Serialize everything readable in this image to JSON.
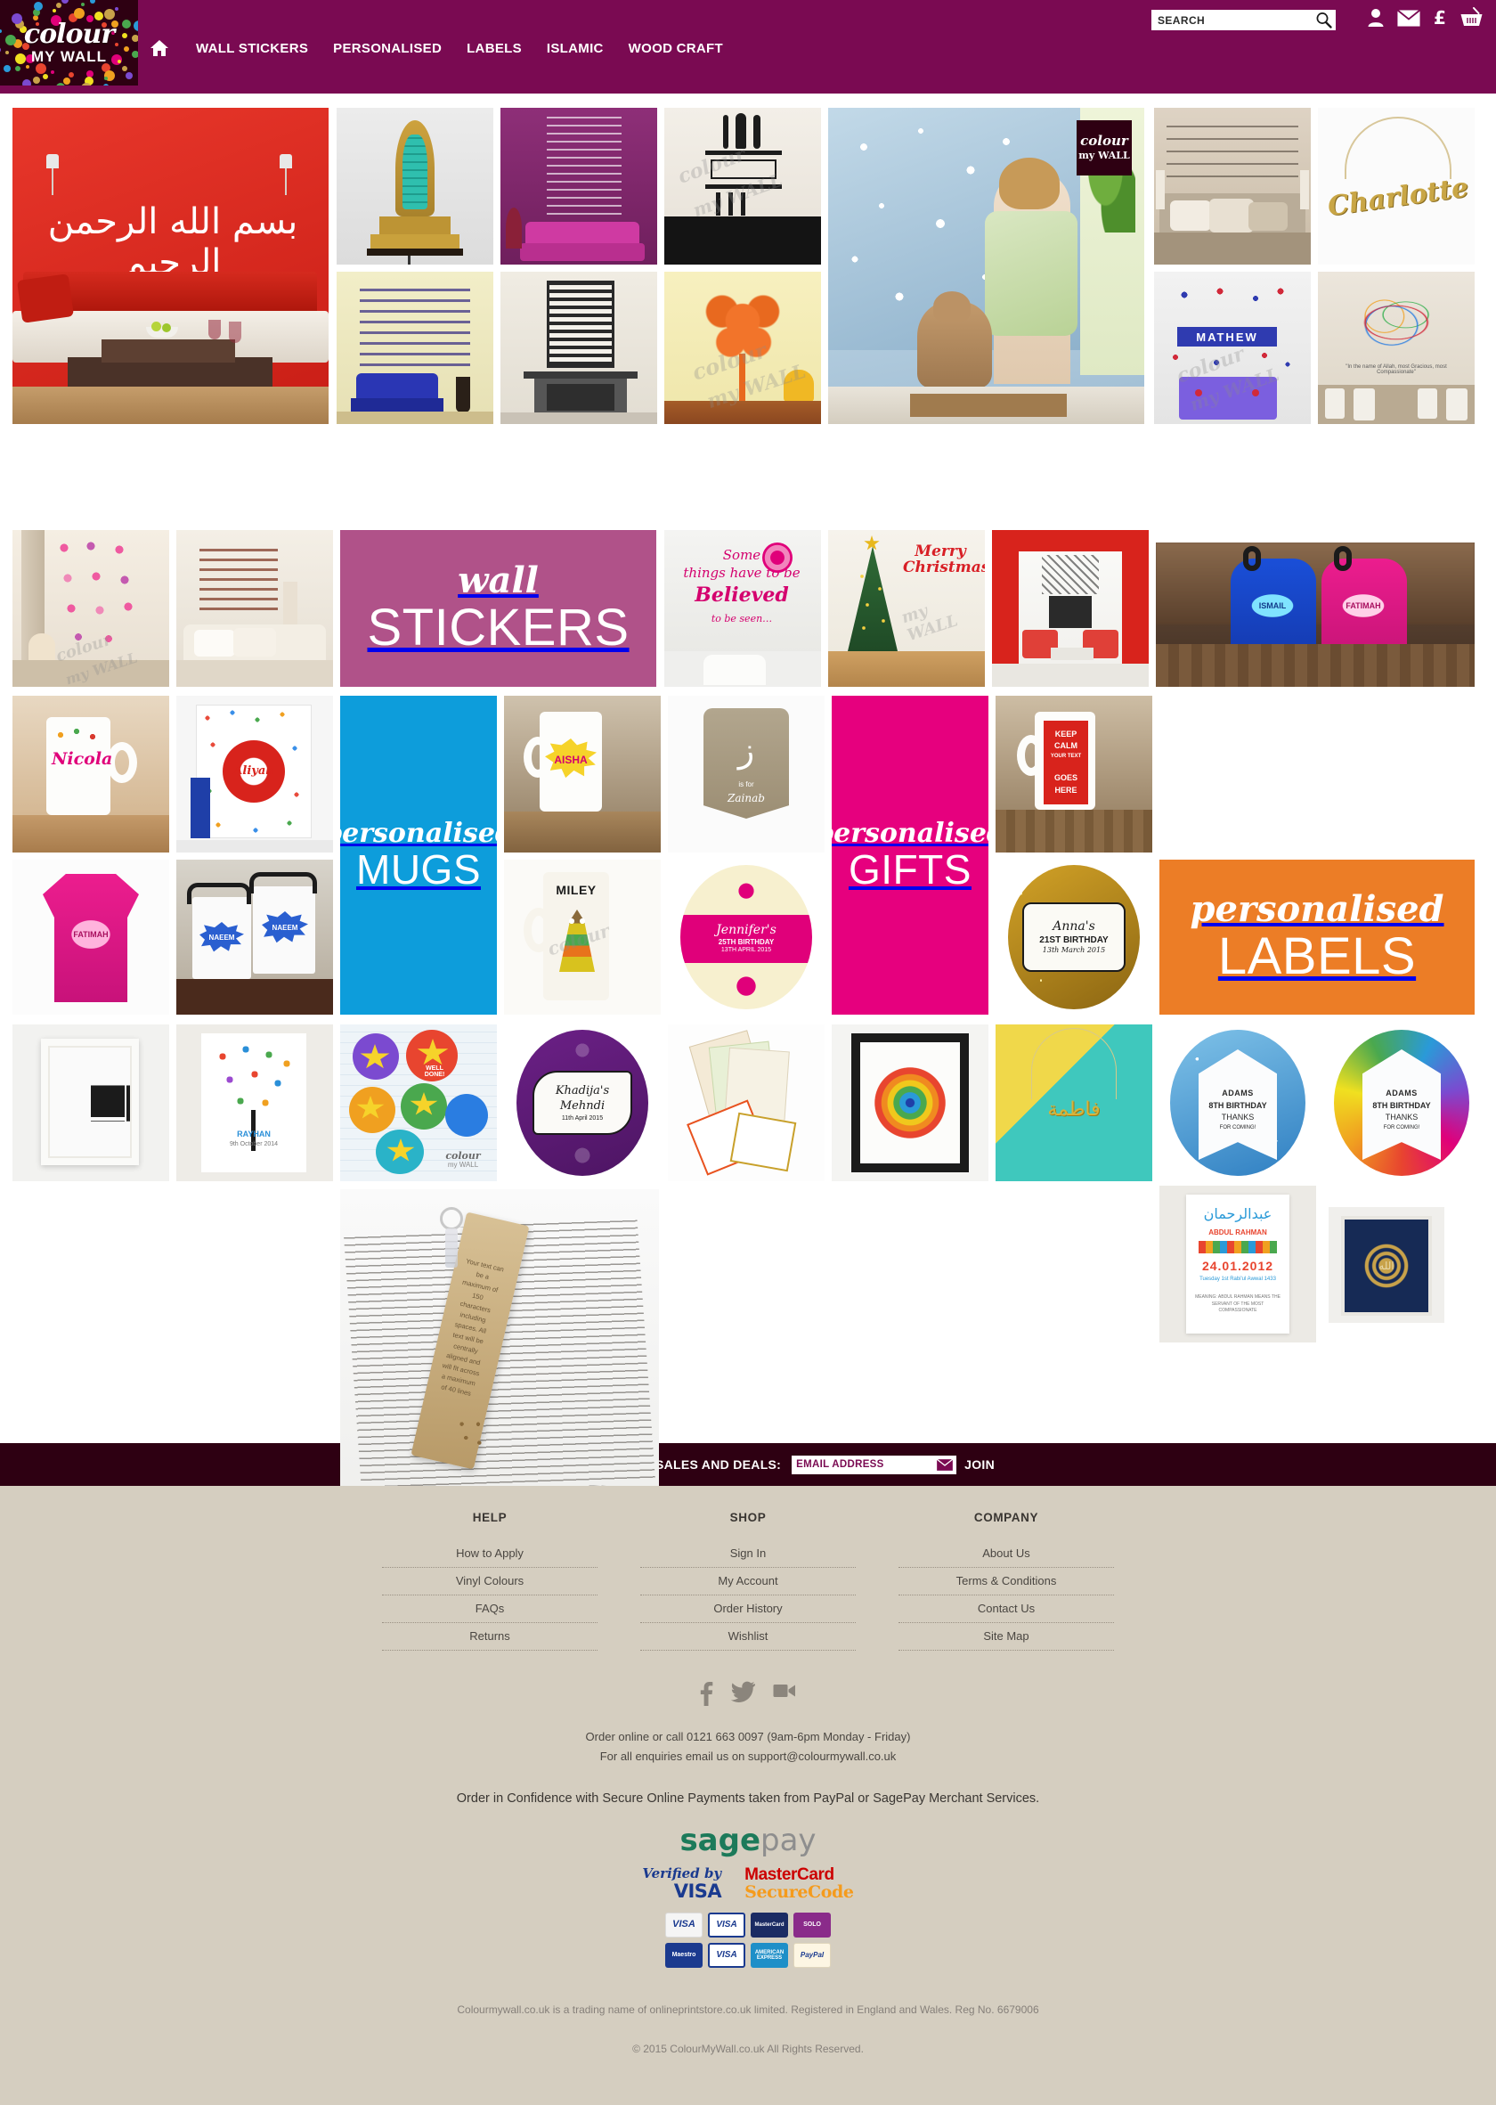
{
  "brand": {
    "logo_line1": "colour",
    "logo_line2": "MY WALL",
    "accent_purple": "#7a0a52",
    "accent_dark": "#2e0012",
    "footer_bg": "#d5cec0"
  },
  "header": {
    "home_icon": "home-icon",
    "nav": [
      {
        "label": "WALL STICKERS"
      },
      {
        "label": "PERSONALISED"
      },
      {
        "label": "LABELS"
      },
      {
        "label": "ISLAMIC"
      },
      {
        "label": "WOOD CRAFT"
      }
    ],
    "search": {
      "placeholder": "SEARCH",
      "value": "",
      "icon": "magnifier-icon"
    },
    "icons": [
      {
        "name": "account-icon",
        "glyph": "user"
      },
      {
        "name": "contact-mail-icon",
        "glyph": "envelope"
      },
      {
        "name": "currency-icon",
        "glyph": "£"
      },
      {
        "name": "basket-icon",
        "glyph": "basket"
      }
    ]
  },
  "mosaic": {
    "promos": [
      {
        "id": "wall-stickers",
        "script": "wall",
        "block": "STICKERS",
        "color": "#b05289"
      },
      {
        "id": "personalised-mugs",
        "script": "personalised",
        "block": "MUGS",
        "color": "#0d9ddb"
      },
      {
        "id": "personalised-gifts",
        "script": "personalised",
        "block": "GIFTS",
        "color": "#e6007e"
      },
      {
        "id": "personalised-labels",
        "script": "personalised",
        "block": "LABELS",
        "color": "#ec7d26"
      }
    ],
    "watermark": "colour my WALL",
    "tiles": [
      {
        "id": "bismillah-red-room",
        "alt": "Bismillah Arabic calligraphy wall sticker in red living room"
      },
      {
        "id": "islamic-lamp-ornament",
        "alt": "Green gold Islamic lamp ornament"
      },
      {
        "id": "purple-ayat-wall",
        "alt": "Arabic ayat wall art on purple wall with pink sofa"
      },
      {
        "id": "kitchen-cutlery-quote",
        "alt": "Eating in the name of Allah kitchen cutlery wall sticker"
      },
      {
        "id": "snowflake-window-girl",
        "alt": "Girl and cat at snowflake window stickers"
      },
      {
        "id": "bedroom-stay-awake-quote",
        "alt": "I could stay awake just to hear you breathing bedroom quote"
      },
      {
        "id": "charlotte-name-necklace",
        "alt": "Charlotte gold name necklace"
      },
      {
        "id": "qul-blue-sofa",
        "alt": "Four Qul Arabic calligraphy above blue armchair"
      },
      {
        "id": "kufic-fireplace",
        "alt": "Kufic square calligraphy above fireplace"
      },
      {
        "id": "orange-tree-sticker",
        "alt": "Orange tree wall sticker with yellow chair"
      },
      {
        "id": "mathew-stars-wall",
        "alt": "MATHEW name with stars above purple drawers"
      },
      {
        "id": "colourful-swirl-arabic",
        "alt": "Colourful swirl Arabic name art in dining room"
      },
      {
        "id": "pink-flowers-wall",
        "alt": "Pink and purple flower wall stickers beside curtain"
      },
      {
        "id": "bedroom-arabic-brown",
        "alt": "Brown Arabic calligraphy above cream bed"
      },
      {
        "id": "some-things-believed",
        "alt": "Some things have to be Believed to be seen quote sticker"
      },
      {
        "id": "merry-christmas-tree",
        "alt": "Merry Christmas sticker beside Christmas tree"
      },
      {
        "id": "red-room-tree-sticker",
        "alt": "Red room with black tree wall sticker"
      },
      {
        "id": "personalised-backpacks",
        "alt": "Blue and pink personalised backpacks ISMAIL and FATIMAH"
      },
      {
        "id": "nicola-mug",
        "alt": "Nicola personalised mug on wooden table"
      },
      {
        "id": "aliyah-polka-bag",
        "alt": "Aliyah red flower polka dot personalised bag"
      },
      {
        "id": "aisha-comic-mug",
        "alt": "AISHA comic burst personalised mug"
      },
      {
        "id": "zainab-cushion",
        "alt": "Z is for Zainab beige cushion"
      },
      {
        "id": "keep-calm-mug",
        "alt": "KEEP CALM YOUR TEXT GOES HERE red mug"
      },
      {
        "id": "fatimah-pink-tshirt",
        "alt": "FATIMAH pink personalised t-shirt"
      },
      {
        "id": "naeem-bags",
        "alt": "NAEEM comic burst personalised bags"
      },
      {
        "id": "miley-owl-mug",
        "alt": "MILEY owl personalised mug"
      },
      {
        "id": "jennifer-birthday-label",
        "alt": "Jennifer's 25th Birthday pink damask label"
      },
      {
        "id": "annas-21st-gold-label",
        "alt": "Anna's 21st Birthday gold glitter label"
      },
      {
        "id": "framed-black-white-art",
        "alt": "Framed black and white Islamic panel art"
      },
      {
        "id": "rayhan-letter-tree",
        "alt": "Rayhan colourful letter tree print"
      },
      {
        "id": "reward-star-stickers",
        "alt": "Well done reward star stickers sheet"
      },
      {
        "id": "khadijas-mehndi-label",
        "alt": "Khadija's Mehndi purple damask label"
      },
      {
        "id": "islamic-card-stack",
        "alt": "Stack of colourful Islamic gift cards"
      },
      {
        "id": "mandala-frame-art",
        "alt": "Rainbow mandala framed art"
      },
      {
        "id": "fatima-gold-necklace",
        "alt": "Fatima Arabic gold name necklace on teal"
      },
      {
        "id": "adams-birthday-blue-label",
        "alt": "ADAMS 8TH BIRTHDAY THANKS FOR COMING blue label"
      },
      {
        "id": "adams-birthday-rainbow-label",
        "alt": "ADAMS 8TH BIRTHDAY THANKS FOR COMING rainbow label"
      },
      {
        "id": "wooden-bookmark",
        "alt": "Engraved wooden personalised bookmark on open book"
      },
      {
        "id": "abdul-rahman-name-print",
        "alt": "ABDUL RAHMAN 24.01.2012 name meaning train print"
      },
      {
        "id": "navy-gold-islamic-art",
        "alt": "Navy and gold Islamic medallion framed art"
      }
    ]
  },
  "newsletter": {
    "label": "SIGN UP TO GET NEWS, SALES AND DEALS:",
    "placeholder": "EMAIL ADDRESS",
    "value": "",
    "envelope_icon": "envelope-icon",
    "join_label": "JOIN"
  },
  "footer": {
    "columns": [
      {
        "title": "HELP",
        "links": [
          "How to Apply",
          "Vinyl Colours",
          "FAQs",
          "Returns"
        ]
      },
      {
        "title": "SHOP",
        "links": [
          "Sign In",
          "My Account",
          "Order History",
          "Wishlist"
        ]
      },
      {
        "title": "COMPANY",
        "links": [
          "About Us",
          "Terms & Conditions",
          "Contact Us",
          "Site Map"
        ]
      }
    ],
    "socials": [
      {
        "name": "facebook-icon"
      },
      {
        "name": "twitter-icon"
      },
      {
        "name": "video-icon"
      }
    ],
    "contact_line1": "Order online or call 0121 663 0097 (9am-6pm Monday - Friday)",
    "contact_line2": "For all enquiries email us on support@colourmywall.co.uk",
    "secure_text": "Order in Confidence with Secure Online Payments taken from PayPal or SagePay Merchant Services.",
    "sagepay": {
      "part1": "sage",
      "part2": "pay"
    },
    "verified_by_visa": {
      "line1": "Verified by",
      "line2": "VISA"
    },
    "mastercard_securecode": {
      "line1": "MasterCard",
      "line2": "SecureCode"
    },
    "cards_row1": [
      {
        "name": "visa-card",
        "label": "VISA"
      },
      {
        "name": "visa-debit-card",
        "label": "VISA"
      },
      {
        "name": "mastercard-card",
        "label": "MasterCard"
      },
      {
        "name": "solo-card",
        "label": "SOLO"
      }
    ],
    "cards_row2": [
      {
        "name": "maestro-card",
        "label": "Maestro"
      },
      {
        "name": "visa-electron-card",
        "label": "VISA"
      },
      {
        "name": "american-express-card",
        "label": "AMERICAN EXPRESS"
      },
      {
        "name": "paypal-card",
        "label": "PayPal"
      }
    ],
    "legal_line1": "Colourmywall.co.uk is a trading name of onlineprintstore.co.uk limited. Registered in England and Wales. Reg No. 6679006",
    "legal_line2": "© 2015 ColourMyWall.co.uk All Rights Reserved."
  }
}
